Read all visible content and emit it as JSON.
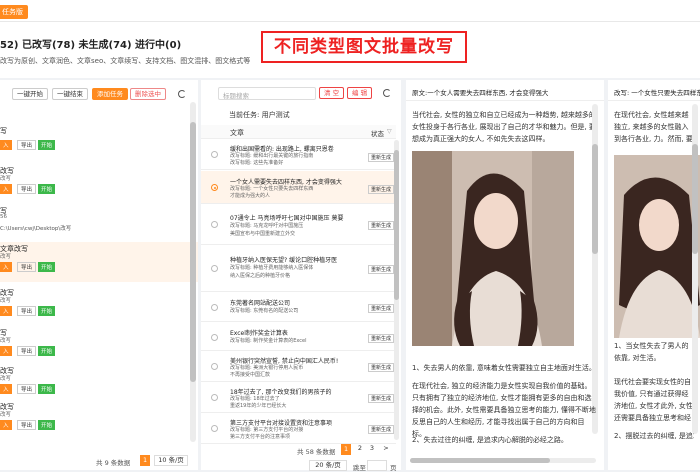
{
  "topbar": {
    "tag": "任务版"
  },
  "stats": {
    "text": "52) 已改写(78) 未生成(74) 进行中(0)"
  },
  "description": "改写为原创、文章润色、文章seo、文章续写、支持文档、图文混排、图文格式等",
  "banner": "不同类型图文批量改写",
  "left_panel": {
    "btn_start": "一键开始",
    "btn_end": "一键结束",
    "btn_add": "添加任务",
    "btn_delete": "删除选中",
    "rows": [
      {
        "title": "写",
        "type": "",
        "b1": "入",
        "b2": "导出",
        "b3": "开始",
        "extra": ""
      },
      {
        "title": "改写",
        "type": "改写",
        "b1": "入",
        "b2": "导出",
        "b3": "开始",
        "extra": ""
      },
      {
        "title": "写",
        "type": "56",
        "b1": "",
        "b2": "",
        "b3": "",
        "extra": "C:\\Users\\cwj\\Desktop\\改写"
      },
      {
        "title": "文章改写",
        "type": "改写",
        "b1": "入",
        "b2": "导出",
        "b3": "开始",
        "extra": ""
      },
      {
        "title": "改写",
        "type": "改写",
        "b1": "入",
        "b2": "导出",
        "b3": "开始",
        "extra": ""
      },
      {
        "title": "写",
        "type": "改写",
        "b1": "入",
        "b2": "导出",
        "b3": "开始",
        "extra": ""
      },
      {
        "title": "改写",
        "type": "改写",
        "b1": "入",
        "b2": "导出",
        "b3": "开始",
        "extra": ""
      },
      {
        "title": "改写",
        "type": "改写",
        "b1": "入",
        "b2": "导出",
        "b3": "开始",
        "extra": ""
      }
    ],
    "pagination": {
      "total": "共 9 条数据",
      "page": "1",
      "per_page": "10 条/页"
    }
  },
  "mid_panel": {
    "search_placeholder": "标题搜索",
    "btn_clear": "清 空",
    "btn_edit": "编 辑",
    "current_task": "当前任务:  用户测试",
    "col_article": "文章",
    "col_status": "状态",
    "articles": [
      {
        "title": "缓和出国需看的: 出现路上, 螺离只恩卷",
        "l2": "改写标题: 缓和出行最关键的旅行指南",
        "l3": "改写标题: 这些先准备好",
        "gen": "重新生成"
      },
      {
        "title": "一个女人需要失去四样东西, 才会变得强大",
        "l2": "改写标题: 一个女性只要失去四样东西",
        "l3": "才能成为强大的人",
        "gen": "重新生成"
      },
      {
        "title": "07通令上 马亮场呼吁七国对中国施压 莫要",
        "l2": "改写标题: 马克龙呼吁对中国施压",
        "l3": "美国宣布与中国重新建立外交",
        "gen": "重新生成"
      },
      {
        "title": "种植牙纳入医保无望? 缓论口腔种植牙医",
        "l2": "改写标题: 种植牙费用能够纳入医保体",
        "l3": "纳入医保之后的种植牙价格",
        "gen": "重新生成"
      },
      {
        "title": "东莞著名网站配送公司",
        "l2": "改写标题: 东莞有名的配送公司",
        "l3": "",
        "gen": "重新生成"
      },
      {
        "title": "Excel制作奖金计算表",
        "l2": "改写标题: 制作奖金计算表的Excel",
        "l3": "",
        "gen": "重新生成"
      },
      {
        "title": "美州银行突然宣誓, 禁止向中国汇人民币!",
        "l2": "改写标题: 美洲大银行停用人民币",
        "l3": "不再接受中国汇款",
        "gen": "重新生成"
      },
      {
        "title": "18年过去了, 那个改变我们的男孩子的",
        "l2": "改写标题: 18年过去了",
        "l3": "重返19年的少年已经长大",
        "gen": "重新生成"
      },
      {
        "title": "第三方支付平台对接设置资和注意事项",
        "l2": "改写标题: 第三方支付平台的对接",
        "l3": "第三方支付平台的注意事项",
        "gen": "重新生成"
      }
    ],
    "pagination": {
      "total": "共 58 条数据",
      "pages": [
        "1",
        "2",
        "3"
      ],
      "next": ">",
      "per_page": "20 条/页",
      "goto": "跳至",
      "page_suffix": "页"
    }
  },
  "original_panel": {
    "header": "原文:一个女人需要失去四样东西, 才会变得强大",
    "p1": "当代社会, 女性的独立和自立已经成为一种趋势, 越来越多的女性投身于各行各业, 展现出了自己的才华和魅力。但是, 要想成为真正强大的女人, 不如先失去这四样。",
    "caption": "1、失去男人的依靠, 意味着女性需要独立自主地面对生活。",
    "p2": "在现代社会, 独立的经济能力是女性实现自我价值的基础。只有拥有了独立的经济地位, 女性才能拥有更多的自由和选择的机会。此外, 女性需要具备独立思考的能力, 懂得不断地反思自己的人生和经历, 才能寻找出属于自己的方向和目标。",
    "p3": "2、失去过往的纠缠, 是追求内心解脱的必经之路。"
  },
  "rewrite_panel": {
    "header": "改写: 一个女性只要失去四样东西",
    "p1": "在现代社会, 女性越来越独立, 来越多的女性融入到各行各业, 力。然而, 要想成为真正强大",
    "caption": "1、当女性失去了男人的依靠, 对生活。",
    "p2": "现代社会要实现女性的自我价值, 只有通过获得经济地位, 女性才此外, 女性还需要具备独立思考和经历, 以找到适合自己的方向。",
    "p3": "2、摆脱过去的纠缠, 是追求"
  }
}
